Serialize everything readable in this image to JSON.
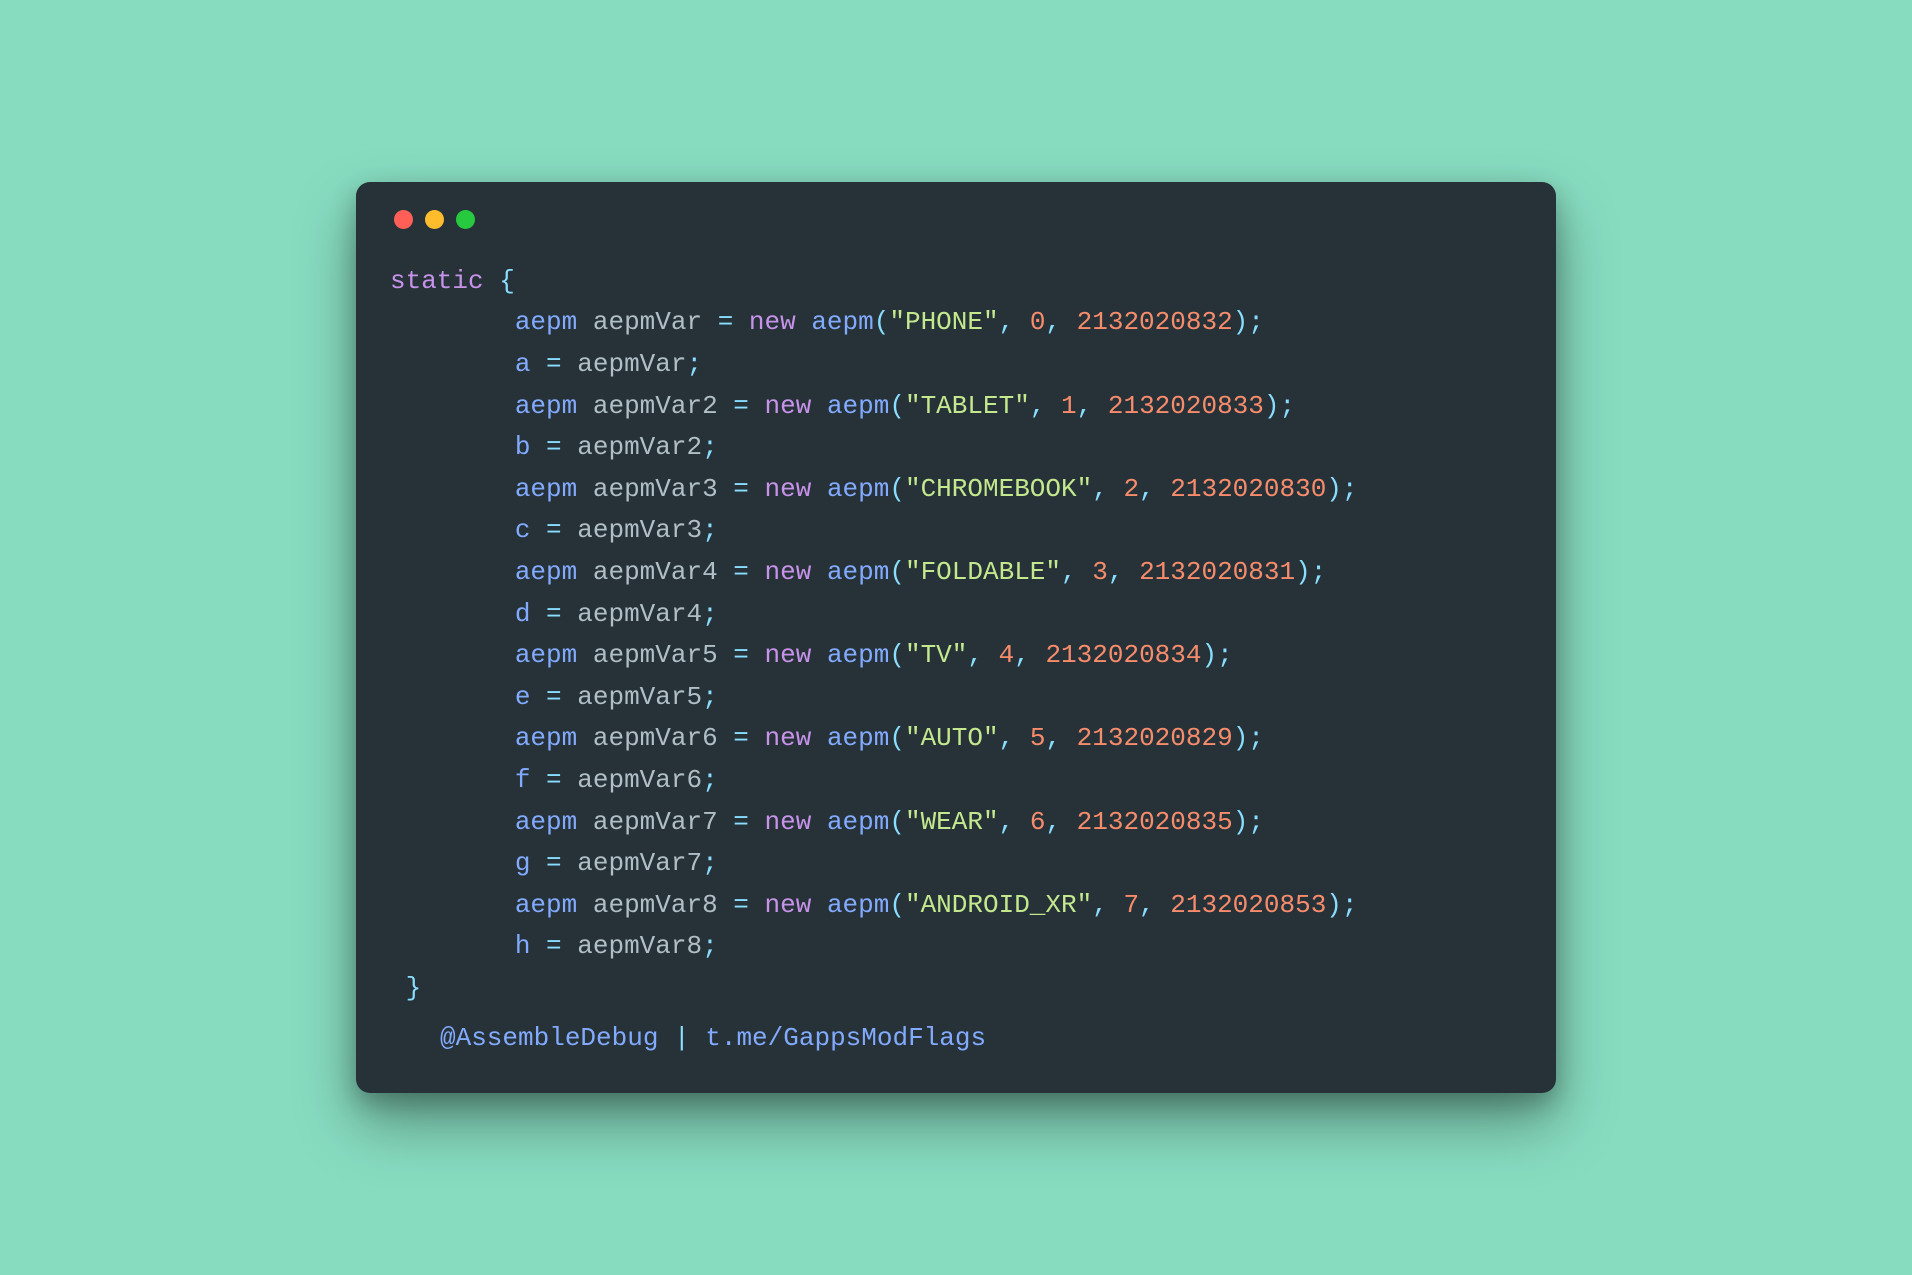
{
  "colors": {
    "background": "#87DCC0",
    "window": "#263238",
    "dot_red": "#FF5F56",
    "dot_yellow": "#FFBD2E",
    "dot_green": "#27C93F",
    "keyword": "#C792EA",
    "type": "#82AAFF",
    "identifier": "#B0BEC5",
    "operator": "#89DDFF",
    "string": "#C3E88D",
    "number": "#F78C6C"
  },
  "entries": [
    {
      "var": "aepmVar",
      "assign": "a",
      "label": "PHONE",
      "idx": 0,
      "id": 2132020832
    },
    {
      "var": "aepmVar2",
      "assign": "b",
      "label": "TABLET",
      "idx": 1,
      "id": 2132020833
    },
    {
      "var": "aepmVar3",
      "assign": "c",
      "label": "CHROMEBOOK",
      "idx": 2,
      "id": 2132020830
    },
    {
      "var": "aepmVar4",
      "assign": "d",
      "label": "FOLDABLE",
      "idx": 3,
      "id": 2132020831
    },
    {
      "var": "aepmVar5",
      "assign": "e",
      "label": "TV",
      "idx": 4,
      "id": 2132020834
    },
    {
      "var": "aepmVar6",
      "assign": "f",
      "label": "AUTO",
      "idx": 5,
      "id": 2132020829
    },
    {
      "var": "aepmVar7",
      "assign": "g",
      "label": "WEAR",
      "idx": 6,
      "id": 2132020835
    },
    {
      "var": "aepmVar8",
      "assign": "h",
      "label": "ANDROID_XR",
      "idx": 7,
      "id": 2132020853
    }
  ],
  "keywords": {
    "static": "static",
    "new": "new"
  },
  "type_name": "aepm",
  "credit": {
    "handle": "@AssembleDebug",
    "sep": " | ",
    "link": "t.me/GappsModFlags"
  }
}
